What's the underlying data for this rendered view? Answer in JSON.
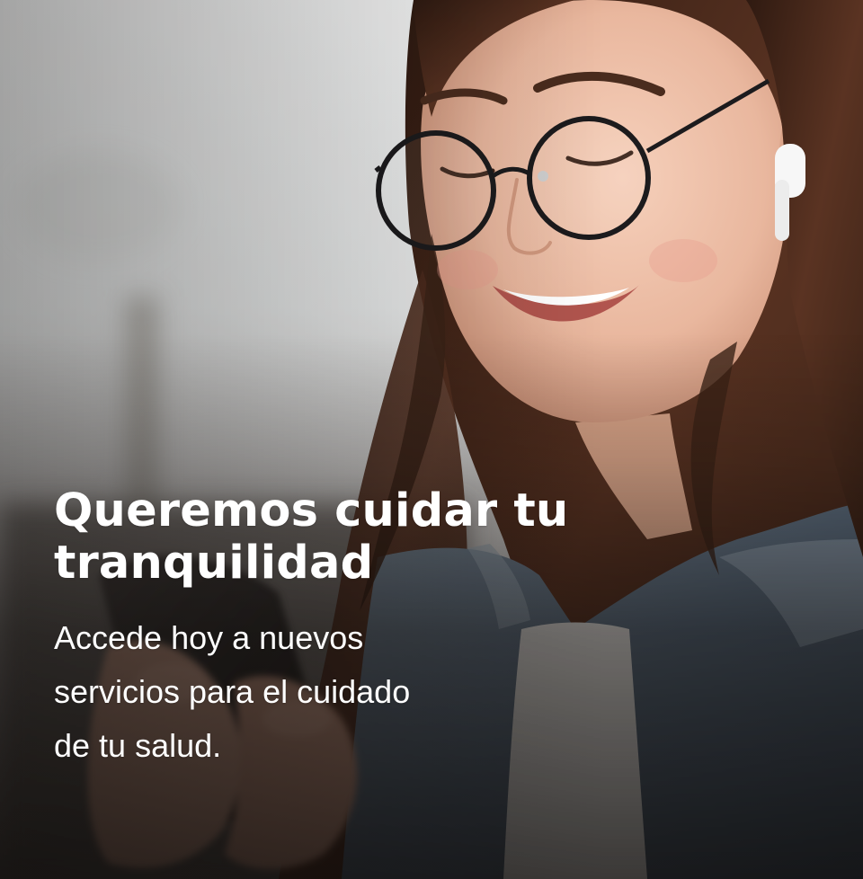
{
  "hero": {
    "photo_icon": "smiling-woman-with-glasses-using-phone-photo",
    "title_lines": [
      "Queremos cuidar tu",
      "tranquilidad"
    ],
    "subtitle_lines": [
      "Accede hoy a nuevos",
      "servicios para el cuidado",
      "de tu salud."
    ],
    "colors": {
      "text": "#ffffff",
      "overlay": "#0a0807",
      "hair": "#4a2a1c",
      "skin": "#e8b69c",
      "denim": "#5d6f82",
      "background": "#f3f4f4"
    }
  }
}
